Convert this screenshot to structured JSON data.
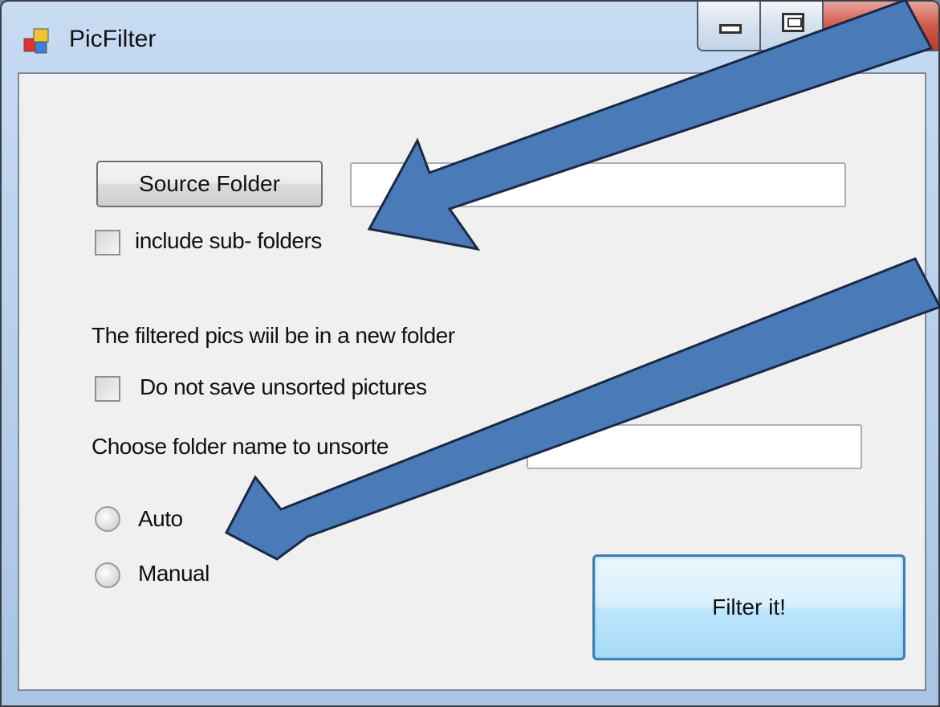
{
  "window": {
    "title": "PicFilter",
    "icon": "app-icon",
    "controls": [
      "minimize-icon",
      "maximize-icon",
      "close-icon"
    ]
  },
  "form": {
    "source_button_label": "Source Folder",
    "source_path_value": "",
    "include_subfolders_label": "include sub- folders",
    "include_subfolders_checked": false,
    "info_text": "The filtered pics wiil be  in a new folder",
    "do_not_save_label": "Do not save unsorted pictures",
    "do_not_save_checked": false,
    "choose_folder_label": "Choose folder name to unsorte",
    "unsorted_folder_value": "",
    "mode_options": [
      "Auto",
      "Manual"
    ],
    "mode_selected": null,
    "filter_button_label": "Filter it!"
  },
  "annotations": {
    "arrow_color": "#4a7ab8",
    "arrow_outline": "#1a2a44",
    "arrows": [
      "arrow-to-include-subfolders",
      "arrow-to-auto-radio"
    ]
  },
  "colors": {
    "client_bg": "#f0f0f0",
    "titlebar": "#b9d1ec",
    "close_button": "#c1392b",
    "focused_button_border": "#3c7fb1"
  }
}
